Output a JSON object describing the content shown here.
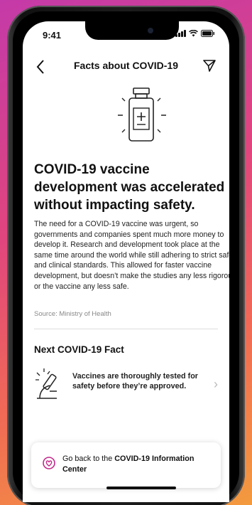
{
  "status_bar": {
    "time": "9:41"
  },
  "nav": {
    "title": "Facts about COVID-19",
    "back_icon": "chevron-left-icon",
    "share_icon": "paper-plane-icon"
  },
  "article": {
    "headline": "COVID-19 vaccine development was accelerated without impacting safety.",
    "body": "The need for a COVID-19 vaccine was urgent, so governments and companies spent much more money to develop it. Research and development took place at the same time around the world while still adhering to strict safety and clinical standards. This allowed for faster vaccine development, but doesn’t make the studies any less rigorous or the vaccine any less safe.",
    "source": "Source: Ministry of Health",
    "illustration": "vaccine-vial-icon"
  },
  "next_fact": {
    "heading": "Next COVID-19 Fact",
    "text": "Vaccines are thoroughly tested for safety before they’re approved.",
    "icon": "microscope-icon"
  },
  "info_card": {
    "prefix": "Go back to the ",
    "link": "COVID-19 Information Center",
    "icon": "heart-icon",
    "accent": "#c2298a"
  }
}
